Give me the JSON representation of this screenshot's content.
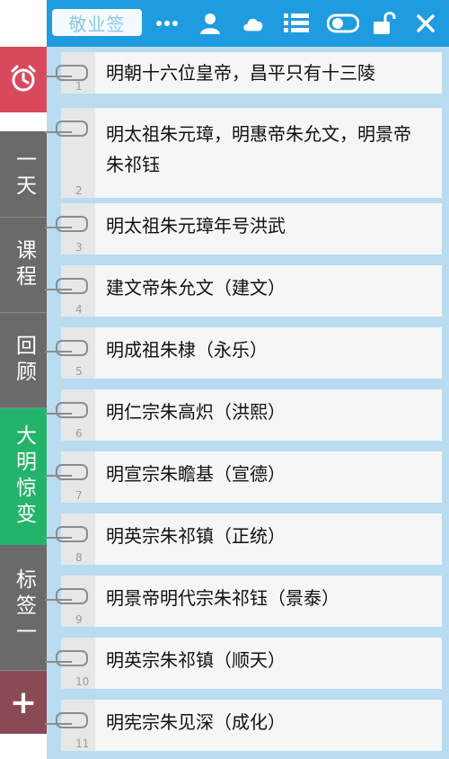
{
  "app": {
    "title": "敬业签"
  },
  "toolbar": {
    "icons": [
      "more-icon",
      "user-icon",
      "cloud-icon",
      "list-icon",
      "toggle-icon",
      "lock-icon",
      "close-icon"
    ]
  },
  "sidebar": {
    "alarm_icon": "alarm-clock-icon",
    "tabs": [
      {
        "label": "一天"
      },
      {
        "label": "课程"
      },
      {
        "label": "回顾"
      },
      {
        "label": "大明惊变"
      },
      {
        "label": "标签一"
      }
    ],
    "add_label": "+"
  },
  "notes": [
    {
      "num": "1",
      "text": "明朝十六位皇帝，昌平只有十三陵"
    },
    {
      "num": "2",
      "text": "明太祖朱元璋，明惠帝朱允文，明景帝朱祁钰"
    },
    {
      "num": "3",
      "text": "明太祖朱元璋年号洪武"
    },
    {
      "num": "4",
      "text": "建文帝朱允文（建文）"
    },
    {
      "num": "5",
      "text": "明成祖朱棣（永乐）"
    },
    {
      "num": "6",
      "text": "明仁宗朱高炽（洪熙）"
    },
    {
      "num": "7",
      "text": "明宣宗朱瞻基（宣德）"
    },
    {
      "num": "8",
      "text": "明英宗朱祁镇（正统）"
    },
    {
      "num": "9",
      "text": "明景帝明代宗朱祁钰（景泰）"
    },
    {
      "num": "10",
      "text": "明英宗朱祁镇（顺天）"
    },
    {
      "num": "11",
      "text": "明宪宗朱见深（成化）"
    }
  ],
  "colors": {
    "topbar": "#1f9be0",
    "alarm": "#d9495e",
    "tab": "#6a6a6a",
    "tab_active": "#24b36b",
    "add": "#8a4a55",
    "notes_bg": "#b9dcf0"
  }
}
